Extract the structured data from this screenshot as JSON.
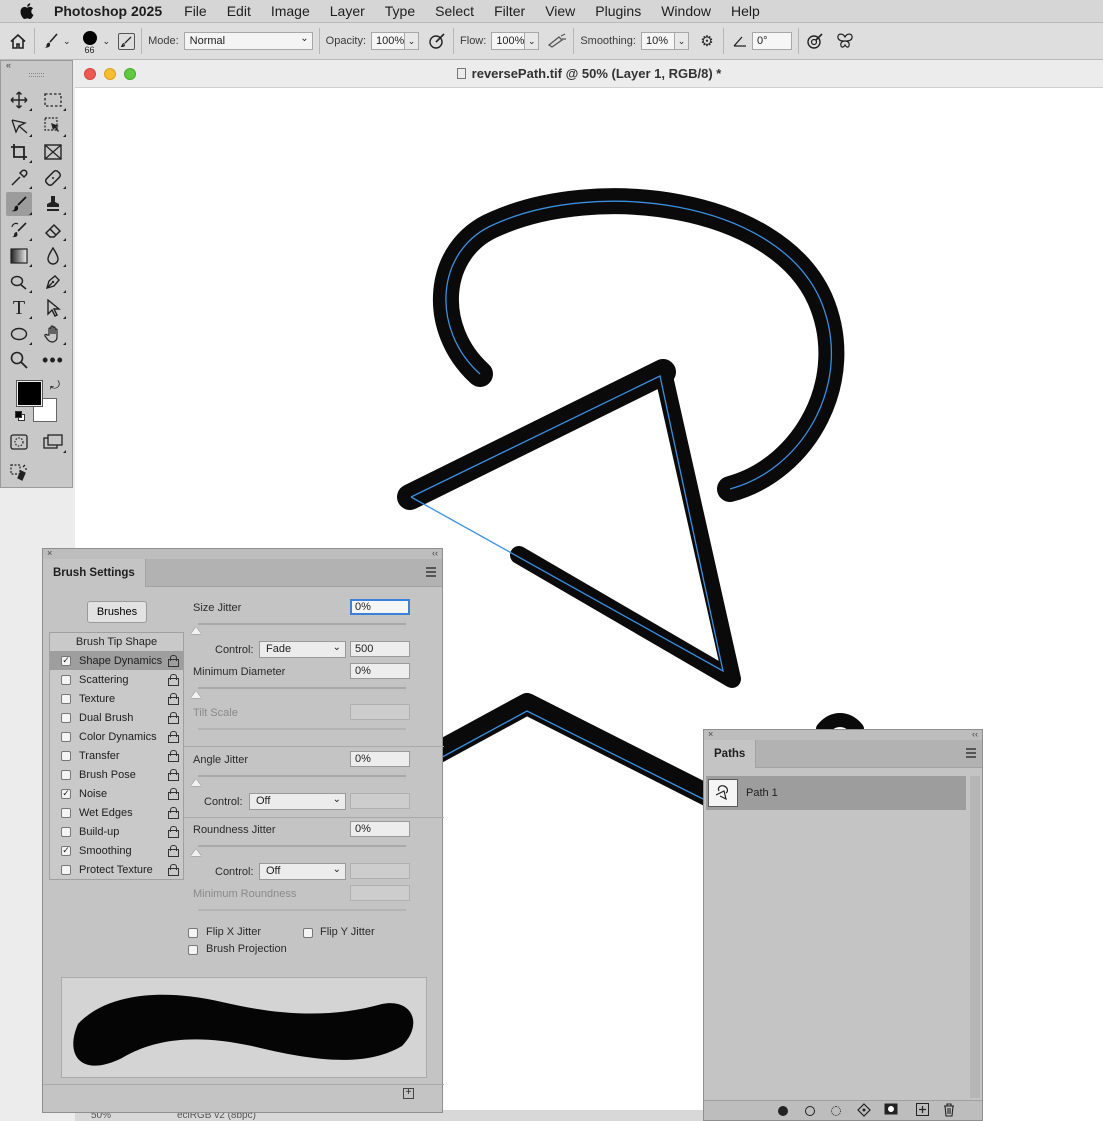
{
  "menubar": {
    "app_name": "Photoshop 2025",
    "items": [
      "File",
      "Edit",
      "Image",
      "Layer",
      "Type",
      "Select",
      "Filter",
      "View",
      "Plugins",
      "Window",
      "Help"
    ]
  },
  "options": {
    "brush_size": "66",
    "mode_label": "Mode:",
    "mode_value": "Normal",
    "opacity_label": "Opacity:",
    "opacity_value": "100%",
    "flow_label": "Flow:",
    "flow_value": "100%",
    "smoothing_label": "Smoothing:",
    "smoothing_value": "10%",
    "angle_value": "0°"
  },
  "document": {
    "title": "reversePath.tif @ 50% (Layer 1, RGB/8) *",
    "status_zoom": "50%",
    "status_profile": "eciRGB v2 (8bpc)"
  },
  "brush_settings": {
    "tab_label": "Brush Settings",
    "brushes_button": "Brushes",
    "list_header": "Brush Tip Shape",
    "options": [
      {
        "label": "Shape Dynamics",
        "checked": "✓"
      },
      {
        "label": "Scattering",
        "checked": ""
      },
      {
        "label": "Texture",
        "checked": ""
      },
      {
        "label": "Dual Brush",
        "checked": ""
      },
      {
        "label": "Color Dynamics",
        "checked": ""
      },
      {
        "label": "Transfer",
        "checked": ""
      },
      {
        "label": "Brush Pose",
        "checked": ""
      },
      {
        "label": "Noise",
        "checked": "✓"
      },
      {
        "label": "Wet Edges",
        "checked": ""
      },
      {
        "label": "Build-up",
        "checked": ""
      },
      {
        "label": "Smoothing",
        "checked": "✓"
      },
      {
        "label": "Protect Texture",
        "checked": ""
      }
    ],
    "size_jitter_label": "Size Jitter",
    "size_jitter_value": "0%",
    "control_label": "Control:",
    "size_control_value": "Fade",
    "fade_steps": "500",
    "min_diameter_label": "Minimum Diameter",
    "min_diameter_value": "0%",
    "tilt_scale_label": "Tilt Scale",
    "angle_jitter_label": "Angle Jitter",
    "angle_jitter_value": "0%",
    "angle_control_value": "Off",
    "roundness_jitter_label": "Roundness Jitter",
    "roundness_jitter_value": "0%",
    "roundness_control_value": "Off",
    "min_roundness_label": "Minimum Roundness",
    "flip_x_label": "Flip X Jitter",
    "flip_y_label": "Flip Y Jitter",
    "brush_projection_label": "Brush Projection"
  },
  "paths_panel": {
    "tab_label": "Paths",
    "items": [
      {
        "name": "Path 1"
      }
    ]
  },
  "colors": {
    "stroke": "#0a0a0a",
    "path_line": "#3a8fe0",
    "foreground": "#000000",
    "background": "#ffffff",
    "focus_ring": "#3b82d6"
  }
}
